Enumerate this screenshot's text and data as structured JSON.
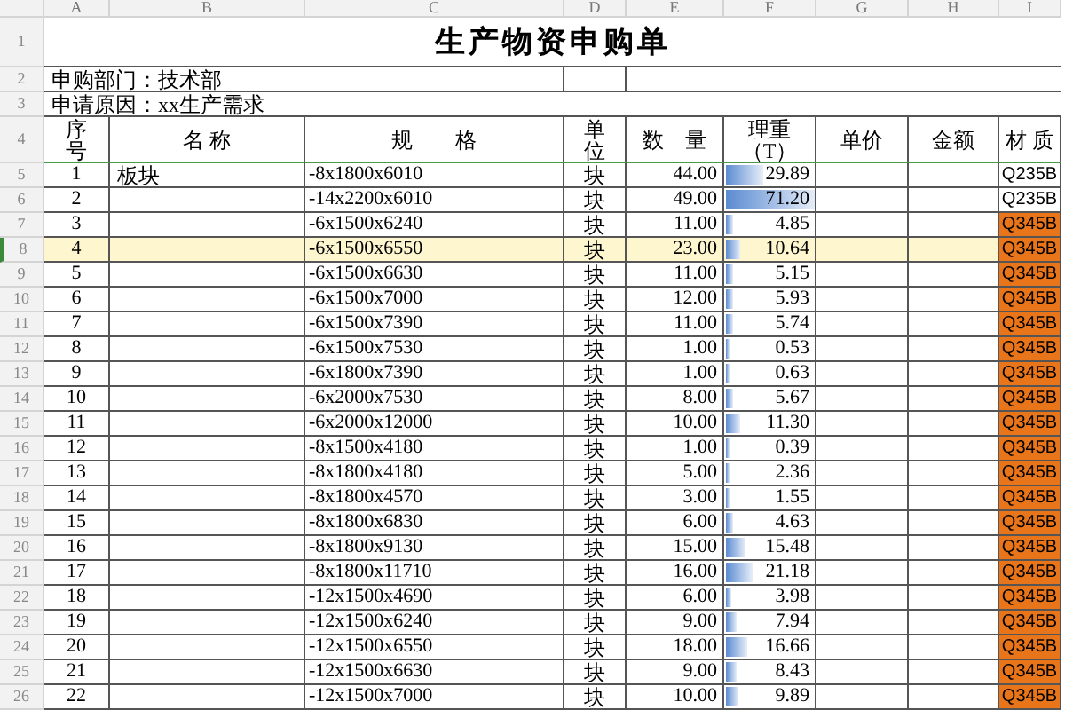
{
  "column_headers": [
    "A",
    "B",
    "C",
    "D",
    "E",
    "F",
    "G",
    "H",
    "I"
  ],
  "title": "生产物资申购单",
  "department": "申购部门：技术部",
  "reason": "申请原因：xx生产需求",
  "table": {
    "columns": [
      [
        "序",
        "号"
      ],
      [
        "名 称"
      ],
      [
        "规　　格"
      ],
      [
        "单",
        "位"
      ],
      [
        "数　量"
      ],
      [
        "理重",
        "（T）"
      ],
      [
        "单价"
      ],
      [
        "金额"
      ],
      [
        "材 质"
      ]
    ],
    "rows": [
      {
        "row_number": "5",
        "seq": "1",
        "name": "板块",
        "spec": "-8x1800x6010",
        "unit": "块",
        "qty": "44.00",
        "weight": "29.89",
        "level": 0.42,
        "material": "Q235B",
        "color": "#ffffff",
        "selected": false
      },
      {
        "row_number": "6",
        "seq": "2",
        "spec": "-14x2200x6010",
        "unit": "块",
        "qty": "49.00",
        "weight": "71.20",
        "level": 1.0,
        "material": "Q235B",
        "color": "#ffffff",
        "selected": false
      },
      {
        "row_number": "7",
        "seq": "3",
        "spec": "-6x1500x6240",
        "unit": "块",
        "qty": "11.00",
        "weight": "4.85",
        "level": 0.07,
        "material": "Q345B",
        "color": "#e8751a",
        "selected": false
      },
      {
        "row_number": "8",
        "seq": "4",
        "spec": "-6x1500x6550",
        "unit": "块",
        "qty": "23.00",
        "weight": "10.64",
        "level": 0.15,
        "material": "Q345B",
        "color": "#e8751a",
        "selected": true
      },
      {
        "row_number": "9",
        "seq": "5",
        "spec": "-6x1500x6630",
        "unit": "块",
        "qty": "11.00",
        "weight": "5.15",
        "level": 0.07,
        "material": "Q345B",
        "color": "#e8751a",
        "selected": false
      },
      {
        "row_number": "10",
        "seq": "6",
        "spec": "-6x1500x7000",
        "unit": "块",
        "qty": "12.00",
        "weight": "5.93",
        "level": 0.08,
        "material": "Q345B",
        "color": "#e8751a",
        "selected": false
      },
      {
        "row_number": "11",
        "seq": "7",
        "spec": "-6x1500x7390",
        "unit": "块",
        "qty": "11.00",
        "weight": "5.74",
        "level": 0.08,
        "material": "Q345B",
        "color": "#e8751a",
        "selected": false
      },
      {
        "row_number": "12",
        "seq": "8",
        "spec": "-6x1500x7530",
        "unit": "块",
        "qty": "1.00",
        "weight": "0.53",
        "level": 0.01,
        "material": "Q345B",
        "color": "#e8751a",
        "selected": false
      },
      {
        "row_number": "13",
        "seq": "9",
        "spec": "-6x1800x7390",
        "unit": "块",
        "qty": "1.00",
        "weight": "0.63",
        "level": 0.01,
        "material": "Q345B",
        "color": "#e8751a",
        "selected": false
      },
      {
        "row_number": "14",
        "seq": "10",
        "spec": "-6x2000x7530",
        "unit": "块",
        "qty": "8.00",
        "weight": "5.67",
        "level": 0.08,
        "material": "Q345B",
        "color": "#e8751a",
        "selected": false
      },
      {
        "row_number": "15",
        "seq": "11",
        "spec": "-6x2000x12000",
        "unit": "块",
        "qty": "10.00",
        "weight": "11.30",
        "level": 0.16,
        "material": "Q345B",
        "color": "#e8751a",
        "selected": false
      },
      {
        "row_number": "16",
        "seq": "12",
        "spec": "-8x1500x4180",
        "unit": "块",
        "qty": "1.00",
        "weight": "0.39",
        "level": 0.01,
        "material": "Q345B",
        "color": "#e8751a",
        "selected": false
      },
      {
        "row_number": "17",
        "seq": "13",
        "spec": "-8x1800x4180",
        "unit": "块",
        "qty": "5.00",
        "weight": "2.36",
        "level": 0.03,
        "material": "Q345B",
        "color": "#e8751a",
        "selected": false
      },
      {
        "row_number": "18",
        "seq": "14",
        "spec": "-8x1800x4570",
        "unit": "块",
        "qty": "3.00",
        "weight": "1.55",
        "level": 0.02,
        "material": "Q345B",
        "color": "#e8751a",
        "selected": false
      },
      {
        "row_number": "19",
        "seq": "15",
        "spec": "-8x1800x6830",
        "unit": "块",
        "qty": "6.00",
        "weight": "4.63",
        "level": 0.07,
        "material": "Q345B",
        "color": "#e8751a",
        "selected": false
      },
      {
        "row_number": "20",
        "seq": "16",
        "spec": "-8x1800x9130",
        "unit": "块",
        "qty": "15.00",
        "weight": "15.48",
        "level": 0.22,
        "material": "Q345B",
        "color": "#e8751a",
        "selected": false
      },
      {
        "row_number": "21",
        "seq": "17",
        "spec": "-8x1800x11710",
        "unit": "块",
        "qty": "16.00",
        "weight": "21.18",
        "level": 0.3,
        "material": "Q345B",
        "color": "#e8751a",
        "selected": false
      },
      {
        "row_number": "22",
        "seq": "18",
        "spec": "-12x1500x4690",
        "unit": "块",
        "qty": "6.00",
        "weight": "3.98",
        "level": 0.06,
        "material": "Q345B",
        "color": "#e8751a",
        "selected": false
      },
      {
        "row_number": "23",
        "seq": "19",
        "spec": "-12x1500x6240",
        "unit": "块",
        "qty": "9.00",
        "weight": "7.94",
        "level": 0.11,
        "material": "Q345B",
        "color": "#e8751a",
        "selected": false
      },
      {
        "row_number": "24",
        "seq": "20",
        "spec": "-12x1500x6550",
        "unit": "块",
        "qty": "18.00",
        "weight": "16.66",
        "level": 0.23,
        "material": "Q345B",
        "color": "#e8751a",
        "selected": false
      },
      {
        "row_number": "25",
        "seq": "21",
        "spec": "-12x1500x6630",
        "unit": "块",
        "qty": "9.00",
        "weight": "8.43",
        "level": 0.12,
        "material": "Q345B",
        "color": "#e8751a",
        "selected": false
      },
      {
        "row_number": "26",
        "seq": "22",
        "spec": "-12x1500x7000",
        "unit": "块",
        "qty": "10.00",
        "weight": "9.89",
        "level": 0.14,
        "material": "Q345B",
        "color": "#e8751a",
        "selected": false
      }
    ]
  },
  "header_row_numbers": [
    "1",
    "2",
    "3",
    "4"
  ]
}
